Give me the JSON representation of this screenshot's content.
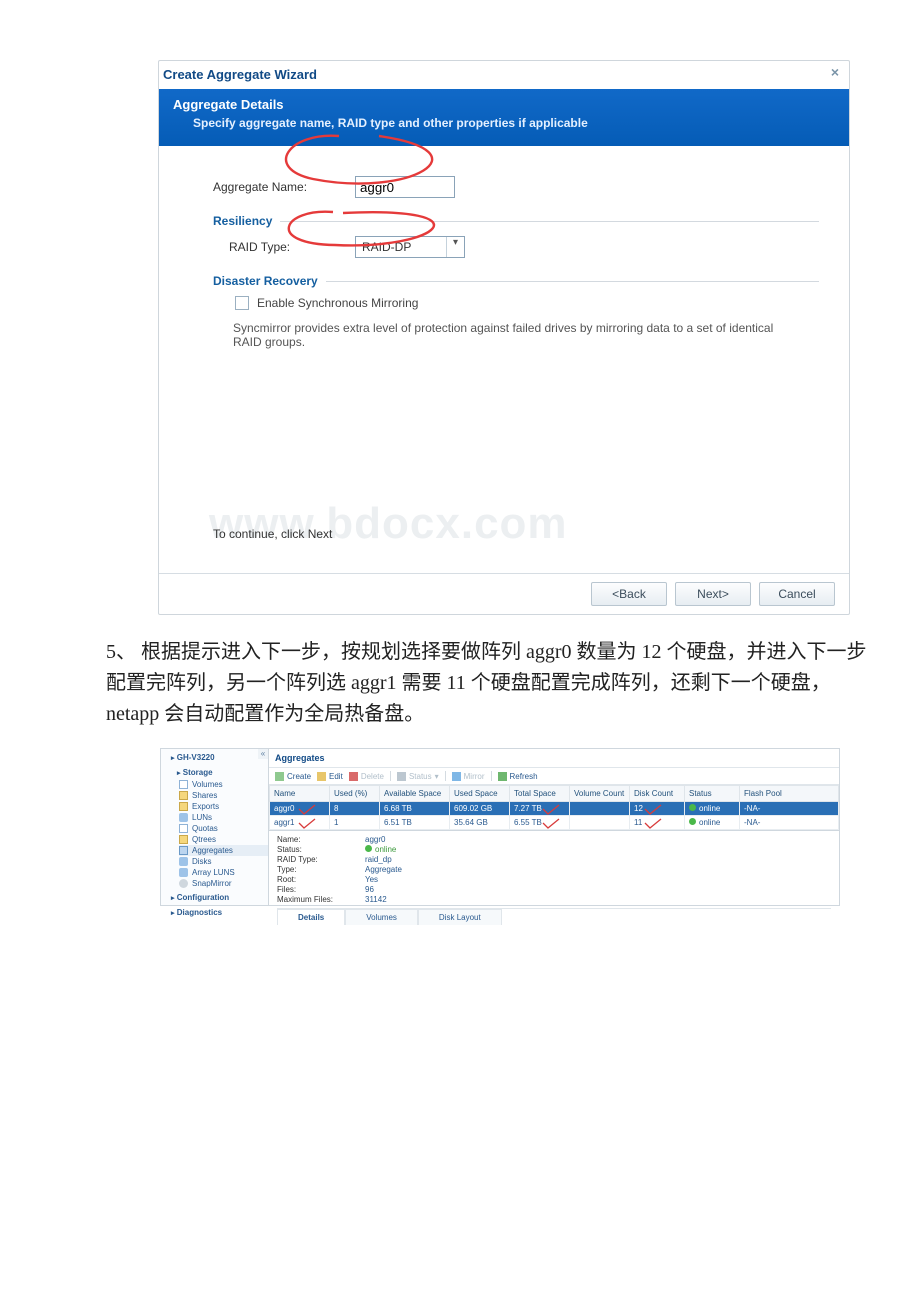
{
  "wizard": {
    "title": "Create Aggregate Wizard",
    "header_title": "Aggregate Details",
    "header_sub": "Specify aggregate name, RAID type and other properties if applicable",
    "name_label": "Aggregate Name:",
    "name_value": "aggr0",
    "resiliency_head": "Resiliency",
    "raid_label": "RAID Type:",
    "raid_value": "RAID-DP",
    "dr_head": "Disaster Recovery",
    "mirror_label": "Enable Synchronous Mirroring",
    "mirror_hint": "Syncmirror provides extra level of protection against failed drives by mirroring data to a set of identical RAID groups.",
    "continue_text": "To continue, click Next",
    "watermark": "www.bdocx.com",
    "buttons": {
      "back": "<Back",
      "next": "Next>",
      "cancel": "Cancel"
    }
  },
  "paragraph": "5、 根据提示进入下一步，按规划选择要做阵列 aggr0 数量为 12 个硬盘，并进入下一步配置完阵列，另一个阵列选 aggr1 需要 11 个硬盘配置完成阵列，还剩下一个硬盘，netapp 会自动配置作为全局热备盘。",
  "mgr": {
    "root": "GH-V3220",
    "storage": "Storage",
    "nav_items": [
      "Volumes",
      "Shares",
      "Exports",
      "LUNs",
      "Quotas",
      "Qtrees",
      "Aggregates",
      "Disks",
      "Array LUNS",
      "SnapMirror"
    ],
    "nav_extra": [
      "Configuration",
      "Diagnostics"
    ],
    "pane_title": "Aggregates",
    "toolbar": {
      "create": "Create",
      "edit": "Edit",
      "delete": "Delete",
      "status": "Status",
      "mirror": "Mirror",
      "refresh": "Refresh"
    },
    "columns": [
      "Name",
      "Used (%)",
      "Available Space",
      "Used Space",
      "Total Space",
      "Volume Count",
      "Disk Count",
      "Status",
      "Flash Pool"
    ],
    "rows": [
      {
        "name": "aggr0",
        "used": "8",
        "avail": "6.68 TB",
        "usedsp": "609.02 GB",
        "total": "7.27 TB",
        "vol": "",
        "disk": "12",
        "status": "online",
        "flash": "-NA-"
      },
      {
        "name": "aggr1",
        "used": "1",
        "avail": "6.51 TB",
        "usedsp": "35.64 GB",
        "total": "6.55 TB",
        "vol": "",
        "disk": "11",
        "status": "online",
        "flash": "-NA-"
      }
    ],
    "details": {
      "Name:": "aggr0",
      "Status:": "online",
      "RAID Type:": "raid_dp",
      "Type:": "Aggregate",
      "Root:": "Yes",
      "Files:": "96",
      "Maximum Files:": "31142"
    },
    "tabs": [
      "Details",
      "Volumes",
      "Disk Layout"
    ]
  }
}
